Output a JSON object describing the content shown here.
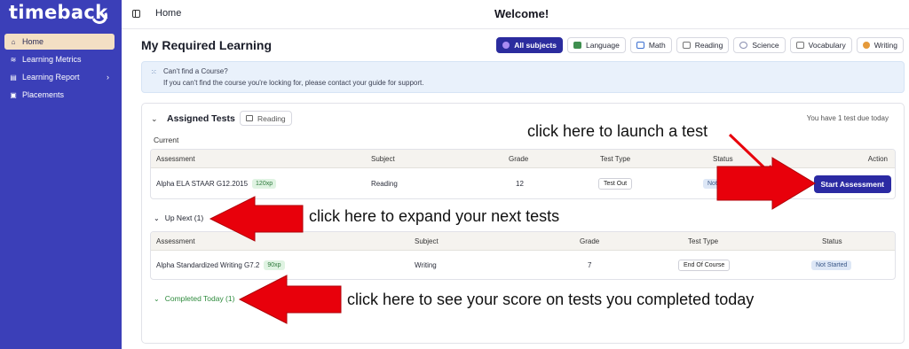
{
  "sidebar": {
    "logo": "timeback",
    "items": [
      {
        "label": "Home",
        "icon": "home-icon"
      },
      {
        "label": "Learning Metrics",
        "icon": "metrics-icon"
      },
      {
        "label": "Learning Report",
        "icon": "report-icon"
      },
      {
        "label": "Placements",
        "icon": "placements-icon"
      }
    ]
  },
  "topbar": {
    "breadcrumb": "Home",
    "welcome": "Welcome!"
  },
  "main": {
    "title": "My Required Learning",
    "filters": [
      "All subjects",
      "Language",
      "Math",
      "Reading",
      "Science",
      "Vocabulary",
      "Writing"
    ],
    "banner": {
      "line1": "Can't find a Course?",
      "line2": "If you can't find the course you're locking for, please contact your guide for support."
    }
  },
  "assigned": {
    "title": "Assigned Tests",
    "subject_chip": "Reading",
    "due_note": "You have 1 test due today",
    "current_label": "Current",
    "headers": [
      "Assessment",
      "Subject",
      "Grade",
      "Test Type",
      "Status",
      "Action"
    ],
    "row": {
      "assessment": "Alpha ELA STAAR G12.2015",
      "xp": "120xp",
      "subject": "Reading",
      "grade": "12",
      "test_type": "Test Out",
      "status": "Not",
      "action": "Start Assessment"
    }
  },
  "upnext": {
    "label": "Up Next (1)",
    "headers": [
      "Assessment",
      "Subject",
      "Grade",
      "Test Type",
      "Status"
    ],
    "row": {
      "assessment": "Alpha Standardized Writing G7.2",
      "xp": "90xp",
      "subject": "Writing",
      "grade": "7",
      "test_type": "End Of Course",
      "status": "Not Started"
    }
  },
  "completed": {
    "label": "Completed Today (1)"
  },
  "annotations": {
    "launch": "click here to launch a test",
    "expand": "click here to expand your next tests",
    "score": "click here to see your score on tests you completed today"
  },
  "colors": {
    "sidebar": "#3b3fb8",
    "accent": "#2b2aa3",
    "arrow": "#e8000b",
    "completed": "#2e8b3d"
  }
}
